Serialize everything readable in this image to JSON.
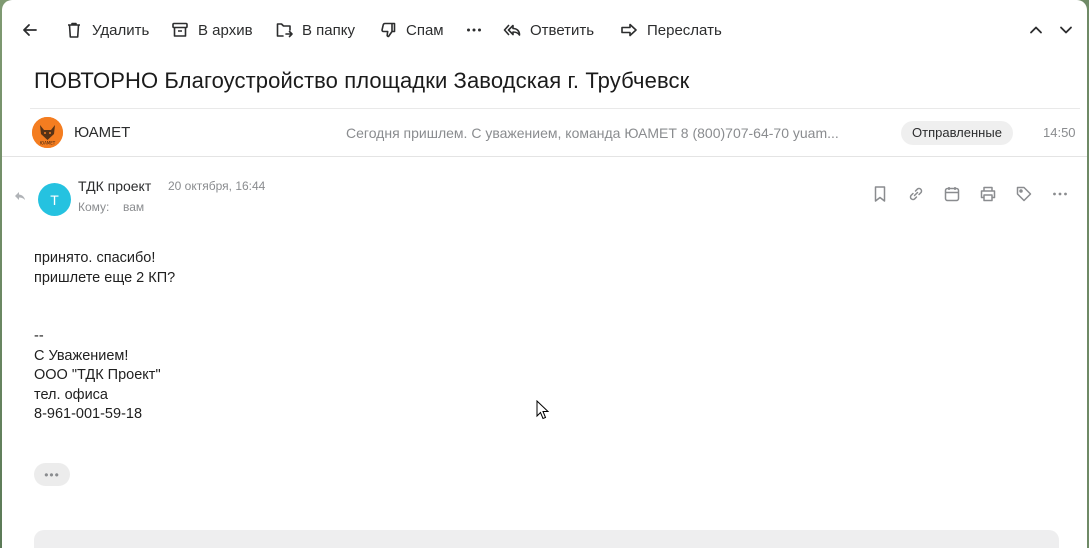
{
  "toolbar": {
    "back_icon": "arrow-left-icon",
    "delete_label": "Удалить",
    "archive_label": "В архив",
    "folder_label": "В папку",
    "spam_label": "Спам",
    "reply_label": "Ответить",
    "forward_label": "Переслать"
  },
  "subject": "ПОВТОРНО Благоустройство площадки Заводская г. Трубчевск",
  "thread": {
    "sender": "ЮАМЕТ",
    "logo_text": "ЮАМЕТ",
    "snippet": "Сегодня пришлем. С уважением, команда ЮАМЕТ 8 (800)707-64-70 yuam...",
    "badge": "Отправленные",
    "time": "14:50"
  },
  "message": {
    "avatar_letter": "Т",
    "sender": "ТДК проект",
    "date": "20 октября, 16:44",
    "to_label": "Кому:",
    "to_value": "вам",
    "body_lines": [
      "принято. спасибо!",
      "пришлете еще 2 КП?",
      "",
      "",
      "--",
      "С Уважением!",
      "ООО \"ТДК Проект\"",
      "тел. офиса",
      "8-961-001-59-18"
    ],
    "more_label": "•••"
  },
  "colors": {
    "accent_avatar": "#25c2e0",
    "brand_logo": "#f47d20",
    "muted_text": "#8a8c8f"
  }
}
